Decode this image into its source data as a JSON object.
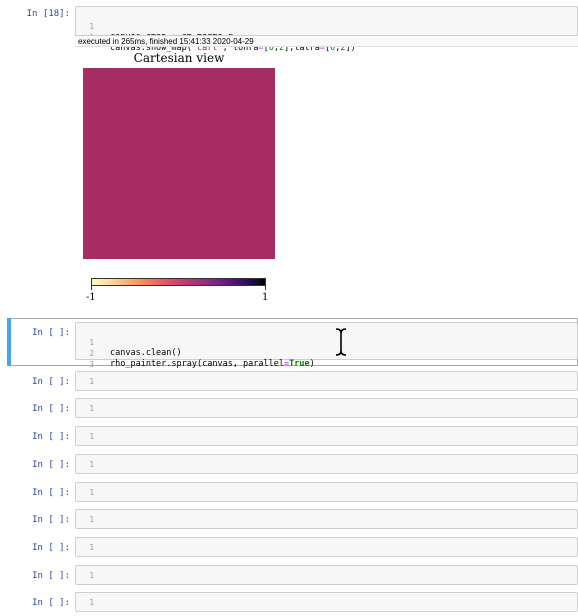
{
  "cells": {
    "cell18": {
      "prompt": "In [18]:",
      "lines": [
        {
          "num": "1",
          "code": "canvas.cmap = cm.magma_r"
        },
        {
          "num": "2",
          "code": "canvas.show_map(\"cart\", lonra=[0,2],latra=[0,2])"
        }
      ],
      "exec_info": "executed in 265ms, finished 15:41:33 2020-04-29"
    },
    "output": {
      "title": "Cartesian view",
      "fill_color": "#a72c63",
      "colorbar": {
        "cmap": "magma_r",
        "min_label": "-1",
        "max_label": "1"
      }
    },
    "active": {
      "prompt": "In [ ]:",
      "lines": [
        {
          "num": "1",
          "code": "canvas.clean()"
        },
        {
          "num": "2",
          "code": "rho_painter.spray(canvas, parallel=True)"
        },
        {
          "num": "3",
          "code": ""
        }
      ]
    },
    "empty": [
      {
        "prompt": "In [ ]:",
        "line_num": "1"
      },
      {
        "prompt": "In [ ]:",
        "line_num": "1"
      },
      {
        "prompt": "In [ ]:",
        "line_num": "1"
      },
      {
        "prompt": "In [ ]:",
        "line_num": "1"
      },
      {
        "prompt": "In [ ]:",
        "line_num": "1"
      },
      {
        "prompt": "In [ ]:",
        "line_num": "1"
      },
      {
        "prompt": "In [ ]:",
        "line_num": "1"
      },
      {
        "prompt": "In [ ]:",
        "line_num": "1"
      },
      {
        "prompt": "In [ ]:",
        "line_num": "1"
      }
    ]
  },
  "colors": {
    "prompt": "#303f9f",
    "active_bar": "#42a5f5",
    "string": "#ba2121",
    "number": "#008000",
    "keyword": "#008000"
  },
  "icons": {
    "cursor": "text-ibeam-cursor-icon"
  }
}
